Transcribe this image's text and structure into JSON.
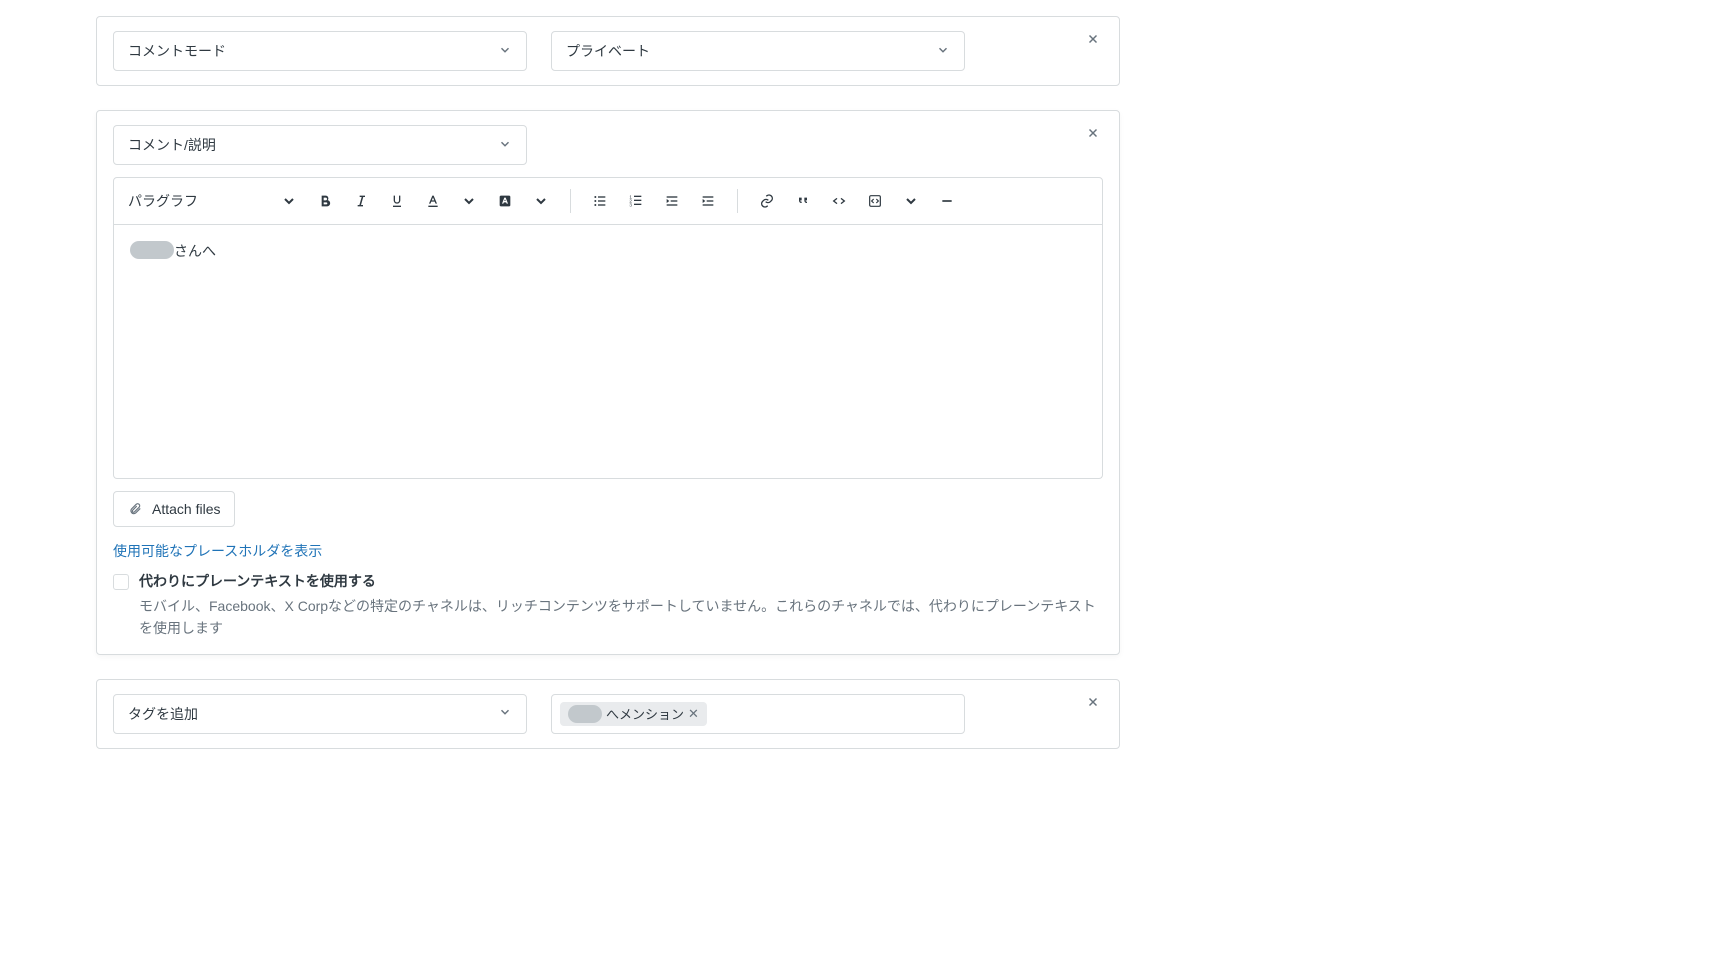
{
  "card1": {
    "select_mode": "コメントモード",
    "select_visibility": "プライベート"
  },
  "card2": {
    "select_type": "コメント/説明",
    "toolbar": {
      "paragraph": "パラグラフ"
    },
    "content_suffix": "さんへ",
    "attach_label": "Attach files",
    "placeholders_link": "使用可能なプレースホルダを表示",
    "plaintext_title": "代わりにプレーンテキストを使用する",
    "plaintext_desc": "モバイル、Facebook、X Corpなどの特定のチャネルは、リッチコンテンツをサポートしていません。これらのチャネルでは、代わりにプレーンテキストを使用します"
  },
  "card3": {
    "select_tag_action": "タグを追加",
    "chip_suffix": "へメンション"
  }
}
